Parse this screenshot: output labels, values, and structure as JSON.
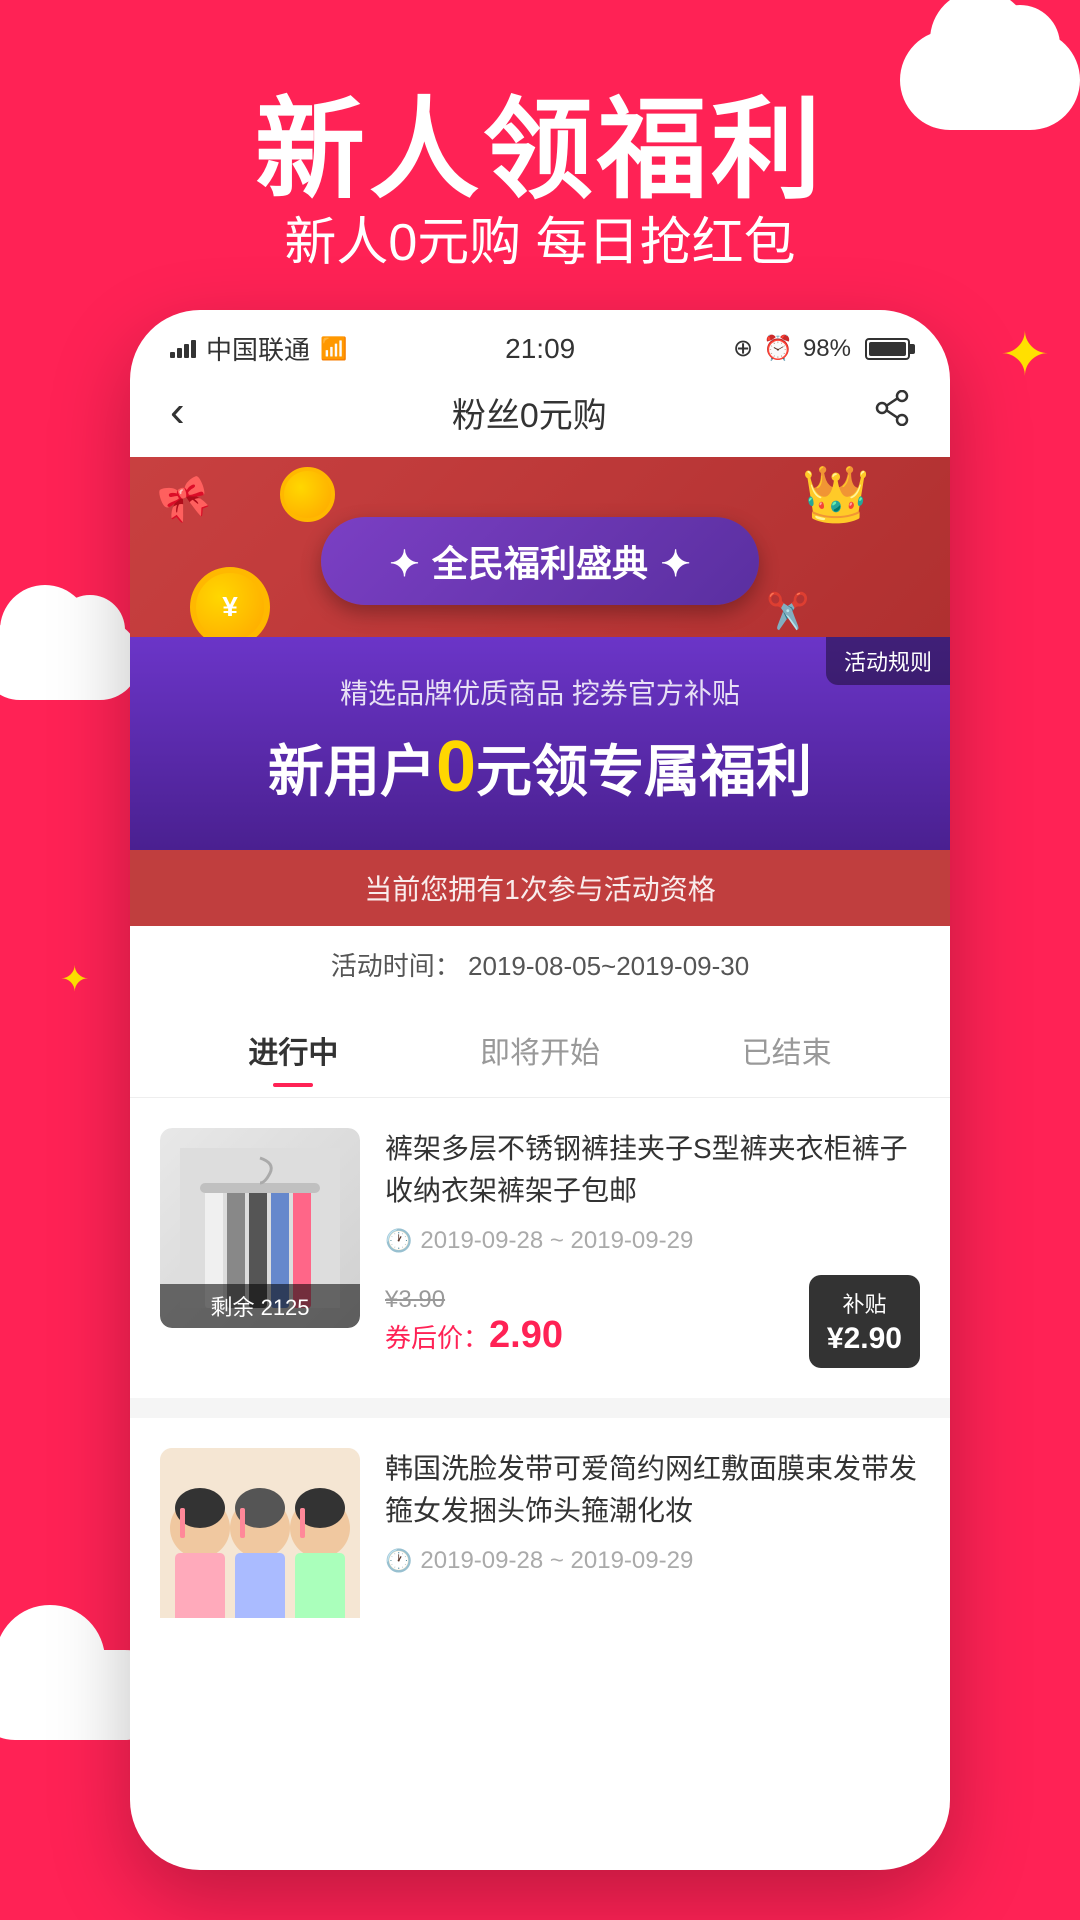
{
  "background": {
    "color": "#ff2255"
  },
  "hero": {
    "title": "新人领福利",
    "subtitle": "新人0元购 每日抢红包"
  },
  "statusBar": {
    "carrier": "中国联通",
    "time": "21:09",
    "battery": "98%"
  },
  "nav": {
    "title": "粉丝0元购",
    "backLabel": "‹",
    "shareLabel": "⎘"
  },
  "banner": {
    "eventTitle": "全民福利盛典",
    "activityRules": "活动规则",
    "promoSubtitle": "精选品牌优质商品 挖券官方补贴",
    "promoMain": "新用户",
    "promoZero": "0",
    "promoSuffix": "元领专属福利",
    "infoBar": "当前您拥有1次参与活动资格",
    "timeLabel": "活动时间：",
    "timeRange": "2019-08-05~2019-09-30"
  },
  "tabs": [
    {
      "label": "进行中",
      "active": true
    },
    {
      "label": "即将开始",
      "active": false
    },
    {
      "label": "已结束",
      "active": false
    }
  ],
  "products": [
    {
      "id": 1,
      "title": "裤架多层不锈钢裤挂夹子S型裤夹衣柜裤子收纳衣架裤架子包邮",
      "dateRange": "2019-09-28 ~ 2019-09-29",
      "originalPrice": "¥3.90",
      "couponPrice": "¥ 2.90",
      "subsidyLabel": "补贴",
      "subsidyPrice": "¥2.90",
      "remaining": "剩余 2125"
    },
    {
      "id": 2,
      "title": "韩国洗脸发带可爱简约网红敷面膜束发带发箍女发捆头饰头箍潮化妆",
      "dateRange": "2019-09-28 ~ 2019-09-29",
      "originalPrice": "",
      "couponPrice": "",
      "subsidyLabel": "",
      "subsidyPrice": "",
      "remaining": ""
    }
  ]
}
